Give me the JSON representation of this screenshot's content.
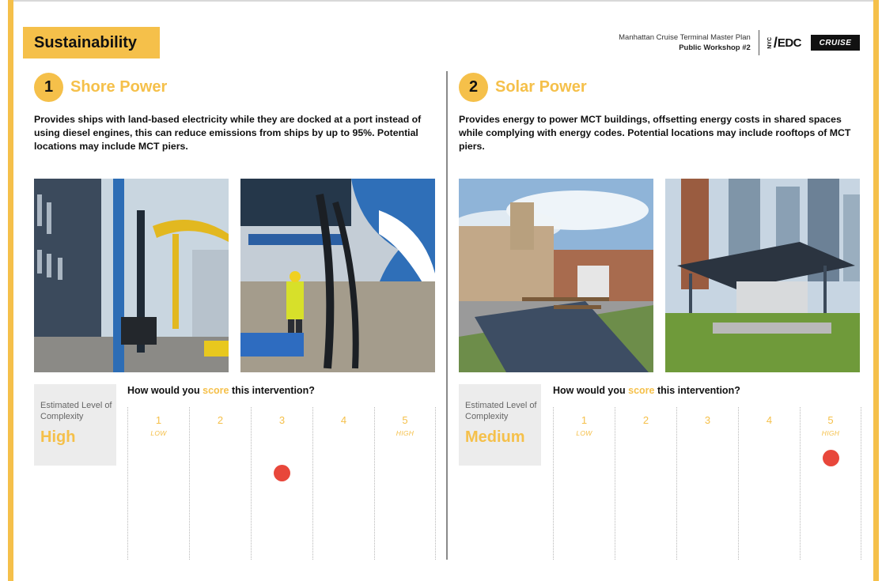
{
  "page": {
    "title": "Sustainability",
    "header_line1": "Manhattan Cruise Terminal Master Plan",
    "header_line2": "Public Workshop #2",
    "logo_edc": "EDC",
    "logo_nyc": "NYC",
    "logo_cruise": "CRUISE"
  },
  "sections": [
    {
      "number": "1",
      "title": "Shore Power",
      "description": "Provides ships with land-based electricity while they are docked at a port instead of using diesel engines, this can reduce emissions from ships by up to 95%. Potential locations may include MCT piers.",
      "complexity_label": "Estimated Level of Complexity",
      "complexity_value": "High",
      "score_question_pre": "How would you ",
      "score_question_highlight": "score",
      "score_question_post": " this intervention?",
      "scores": [
        {
          "n": "1",
          "tag": "LOW"
        },
        {
          "n": "2",
          "tag": ""
        },
        {
          "n": "3",
          "tag": ""
        },
        {
          "n": "4",
          "tag": ""
        },
        {
          "n": "5",
          "tag": "HIGH"
        }
      ],
      "vote_score": 3,
      "photos": [
        "cruise-ship-shore-power-crane-photo",
        "worker-shore-power-connection-photo"
      ]
    },
    {
      "number": "2",
      "title": "Solar Power",
      "description": "Provides energy to power MCT buildings, offsetting energy costs in shared spaces while complying with energy codes. Potential locations may include rooftops of MCT piers.",
      "complexity_label": "Estimated Level of Complexity",
      "complexity_value": "Medium",
      "score_question_pre": "How would you ",
      "score_question_highlight": "score",
      "score_question_post": " this intervention?",
      "scores": [
        {
          "n": "1",
          "tag": "LOW"
        },
        {
          "n": "2",
          "tag": ""
        },
        {
          "n": "3",
          "tag": ""
        },
        {
          "n": "4",
          "tag": ""
        },
        {
          "n": "5",
          "tag": "HIGH"
        }
      ],
      "vote_score": 5,
      "photos": [
        "rooftop-solar-patio-photo",
        "solar-canopy-green-roof-photo"
      ]
    }
  ],
  "colors": {
    "accent": "#f5c04a",
    "vote": "#e8473b",
    "complexity_bg": "#ececec"
  }
}
